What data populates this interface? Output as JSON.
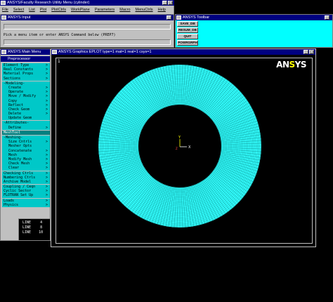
{
  "utility_menu": {
    "title": "ANSYS/Faculty Research Utility Menu (cylinder)",
    "items": [
      "File",
      "Select",
      "List",
      "Plot",
      "PlotCtrls",
      "WorkPlane",
      "Parameters",
      "Macro",
      "MenuCtrls",
      "Help"
    ]
  },
  "input_window": {
    "title": "ANSYS Input",
    "prompt": "Pick a menu item or enter ANSYS Command below (PREP7)"
  },
  "toolbar": {
    "title": "ANSYS Toolbar",
    "buttons": [
      "SAVE_DB",
      "RESUM_DB",
      "QUIT",
      "POWRGRPH"
    ]
  },
  "main_menu": {
    "title": "ANSYS Main Menu",
    "submenu_title": "Preprocessor",
    "items": [
      {
        "label": "Element Type",
        "arrow": true,
        "indent": false
      },
      {
        "label": "Real Constants",
        "arrow": true,
        "indent": false
      },
      {
        "label": "Material Props",
        "arrow": true,
        "indent": false
      },
      {
        "label": "Sections",
        "arrow": true,
        "indent": false
      },
      {
        "label": "-Modeling-",
        "arrow": false,
        "indent": false
      },
      {
        "label": "Create",
        "arrow": true,
        "indent": true
      },
      {
        "label": "Operate",
        "arrow": true,
        "indent": true
      },
      {
        "label": "Move / Modify",
        "arrow": true,
        "indent": true
      },
      {
        "label": "Copy",
        "arrow": true,
        "indent": true
      },
      {
        "label": "Reflect",
        "arrow": true,
        "indent": true
      },
      {
        "label": "Check Geom",
        "arrow": true,
        "indent": true
      },
      {
        "label": "Delete",
        "arrow": true,
        "indent": true
      },
      {
        "label": "Update Geom",
        "arrow": false,
        "indent": true
      },
      {
        "label": "-Attributes-",
        "arrow": false,
        "indent": false
      },
      {
        "label": "Define",
        "arrow": true,
        "indent": true
      },
      {
        "label": "MeshTool",
        "arrow": false,
        "indent": false,
        "selected": true
      },
      {
        "label": "-Meshing-",
        "arrow": false,
        "indent": false
      },
      {
        "label": "Size Cntrls",
        "arrow": true,
        "indent": true
      },
      {
        "label": "Mesher Opts",
        "arrow": false,
        "indent": true
      },
      {
        "label": "Concatenate",
        "arrow": true,
        "indent": true
      },
      {
        "label": "Mesh",
        "arrow": true,
        "indent": true
      },
      {
        "label": "Modify Mesh",
        "arrow": true,
        "indent": true
      },
      {
        "label": "Check Mesh",
        "arrow": true,
        "indent": true
      },
      {
        "label": "Clear",
        "arrow": true,
        "indent": true
      },
      {
        "label": "Checking Ctrls",
        "arrow": true,
        "indent": false
      },
      {
        "label": "Numbering Ctrls",
        "arrow": true,
        "indent": false
      },
      {
        "label": "Archive Model",
        "arrow": true,
        "indent": false
      },
      {
        "label": "Coupling / Ceqn",
        "arrow": true,
        "indent": false
      },
      {
        "label": "Cyclic Sector",
        "arrow": true,
        "indent": false
      },
      {
        "label": "FLOTRAN Set Up",
        "arrow": true,
        "indent": false
      },
      {
        "label": "Loads",
        "arrow": true,
        "indent": false
      },
      {
        "label": "Physics",
        "arrow": true,
        "indent": false
      }
    ]
  },
  "graphics": {
    "title": "ANSYS Graphics   EPLOT   type=1 mat=1 real=1 csys=1",
    "window_number": "1",
    "logo_an": "AN",
    "logo_s": "S",
    "logo_ys": "YS",
    "triad": {
      "x": "X",
      "y": "Y",
      "z": "Z"
    },
    "mesh_color": "#33ffff",
    "grid_color": "#006b6b"
  },
  "output": {
    "lines": [
      "LINE",
      "LINE",
      "LINE"
    ],
    "values": [
      "4",
      "8",
      "10"
    ]
  }
}
